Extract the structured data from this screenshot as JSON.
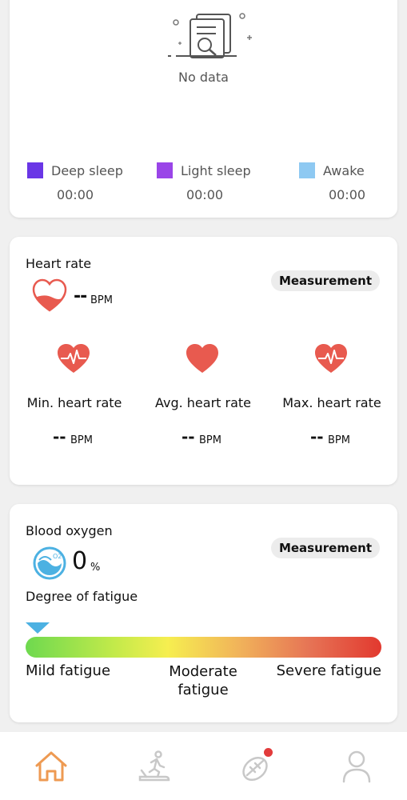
{
  "sleep": {
    "no_data_text": "No data",
    "legend": [
      {
        "label": "Deep sleep",
        "value": "00:00",
        "color": "#6a36e6"
      },
      {
        "label": "Light sleep",
        "value": "00:00",
        "color": "#9a45e8"
      },
      {
        "label": "Awake",
        "value": "00:00",
        "color": "#8ec9f2"
      }
    ]
  },
  "heart_rate": {
    "title": "Heart rate",
    "measurement_label": "Measurement",
    "current_value": "--",
    "unit": "BPM",
    "stats": [
      {
        "label": "Min. heart rate",
        "value": "--",
        "unit": "BPM"
      },
      {
        "label": "Avg. heart rate",
        "value": "--",
        "unit": "BPM"
      },
      {
        "label": "Max. heart rate",
        "value": "--",
        "unit": "BPM"
      }
    ],
    "accent_color": "#e85a4f"
  },
  "blood_oxygen": {
    "title": "Blood oxygen",
    "measurement_label": "Measurement",
    "value": "0",
    "unit": "%",
    "icon_label": "O2",
    "fatigue": {
      "title": "Degree of fatigue",
      "level": 0,
      "mild_label": "Mild fatigue",
      "moderate_label": "Moderate fatigue",
      "severe_label": "Severe fatigue",
      "marker_color": "#4cb1e2"
    }
  },
  "nav": {
    "items": [
      {
        "name": "home-icon",
        "active": true
      },
      {
        "name": "exercise-icon",
        "active": false
      },
      {
        "name": "discover-icon",
        "active": false,
        "badge": true
      },
      {
        "name": "profile-icon",
        "active": false
      }
    ],
    "active_color": "#ee9a52",
    "inactive_color": "#c8c8c8"
  }
}
